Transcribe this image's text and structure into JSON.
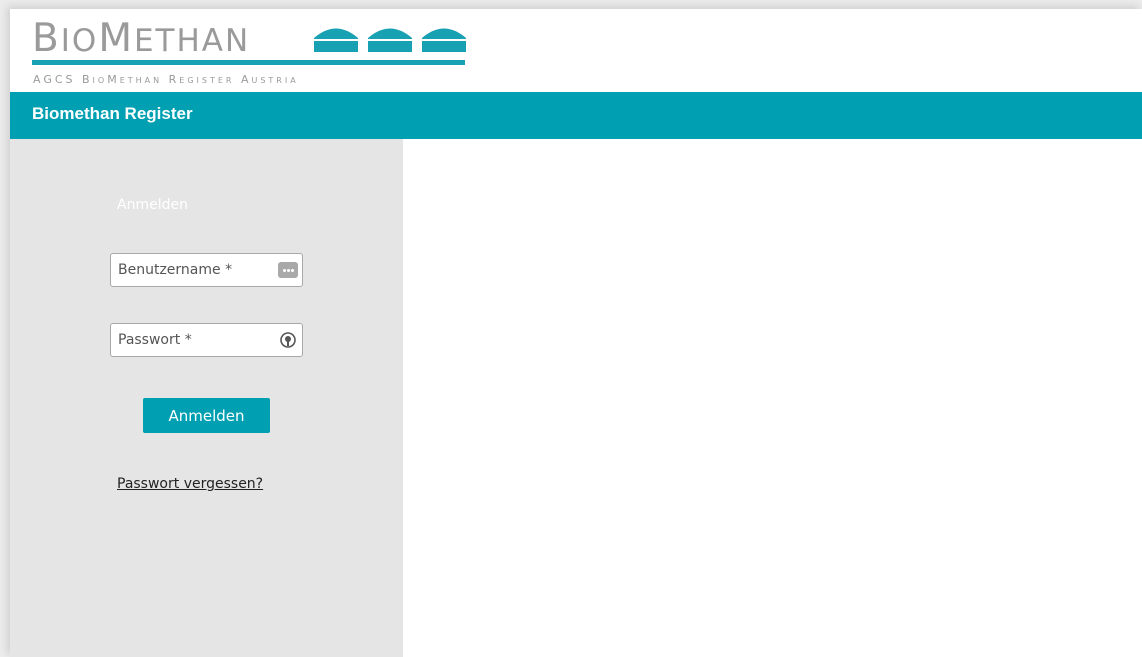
{
  "logo": {
    "title_initial_1": "B",
    "title_rest_1": "IO",
    "title_initial_2": "M",
    "title_rest_2": "ETHAN",
    "subtitle": "AGCS BioMethan Register Austria",
    "icon": "three-domes-logo",
    "color": "#18a1b2"
  },
  "titlebar": {
    "title": "Biomethan Register"
  },
  "login": {
    "heading": "Anmelden",
    "username_placeholder": "Benutzername *",
    "username_value": "",
    "username_icon": "password-manager-dots-icon",
    "password_placeholder": "Passwort *",
    "password_value": "",
    "password_icon": "key-icon",
    "submit_label": "Anmelden",
    "forgot_label": "Passwort vergessen?"
  },
  "colors": {
    "accent": "#00a0b2",
    "sidebar_bg": "#e5e5e5",
    "logo_gray": "#9a9a9a"
  }
}
